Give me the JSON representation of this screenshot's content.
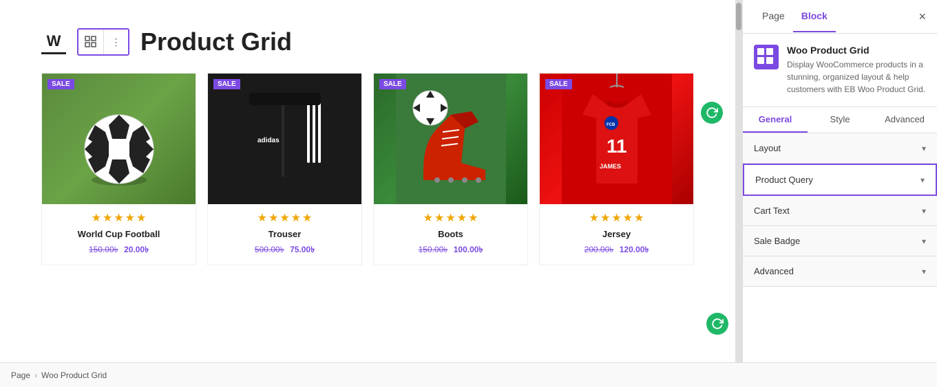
{
  "page_title": "Product Grid",
  "toolbar": {
    "grid_icon": "⊞",
    "more_icon": "⋮"
  },
  "panel": {
    "tab_page": "Page",
    "tab_block": "Block",
    "close": "×",
    "plugin_name": "Woo Product Grid",
    "plugin_desc": "Display WooCommerce products in a stunning, organized layout & help customers with EB Woo Product Grid.",
    "sub_tabs": [
      "General",
      "Style",
      "Advanced"
    ],
    "active_sub_tab": "General",
    "sections": [
      {
        "id": "layout",
        "label": "Layout",
        "active": false
      },
      {
        "id": "product-query",
        "label": "Product Query",
        "active": true
      },
      {
        "id": "cart-text",
        "label": "Cart Text",
        "active": false
      },
      {
        "id": "sale-badge",
        "label": "Sale Badge",
        "active": false
      },
      {
        "id": "advanced",
        "label": "Advanced",
        "active": false
      }
    ]
  },
  "products": [
    {
      "id": 1,
      "name": "World Cup Football",
      "sale_badge": "SALE",
      "price_original": "150.00৳",
      "price_sale": "20.00৳",
      "stars": [
        1,
        1,
        1,
        1,
        1
      ],
      "img_type": "football"
    },
    {
      "id": 2,
      "name": "Trouser",
      "sale_badge": "SALE",
      "price_original": "500.00৳",
      "price_sale": "75.00৳",
      "stars": [
        1,
        1,
        1,
        1,
        1
      ],
      "img_type": "trouser"
    },
    {
      "id": 3,
      "name": "Boots",
      "sale_badge": "SALE",
      "price_original": "150.00৳",
      "price_sale": "100.00৳",
      "stars": [
        1,
        1,
        1,
        1,
        1
      ],
      "img_type": "boots"
    },
    {
      "id": 4,
      "name": "Jersey",
      "sale_badge": "SALE",
      "price_original": "200.00৳",
      "price_sale": "120.00৳",
      "stars": [
        1,
        1,
        1,
        1,
        1
      ],
      "img_type": "jersey"
    }
  ],
  "breadcrumb": {
    "page": "Page",
    "separator": "›",
    "current": "Woo Product Grid"
  }
}
